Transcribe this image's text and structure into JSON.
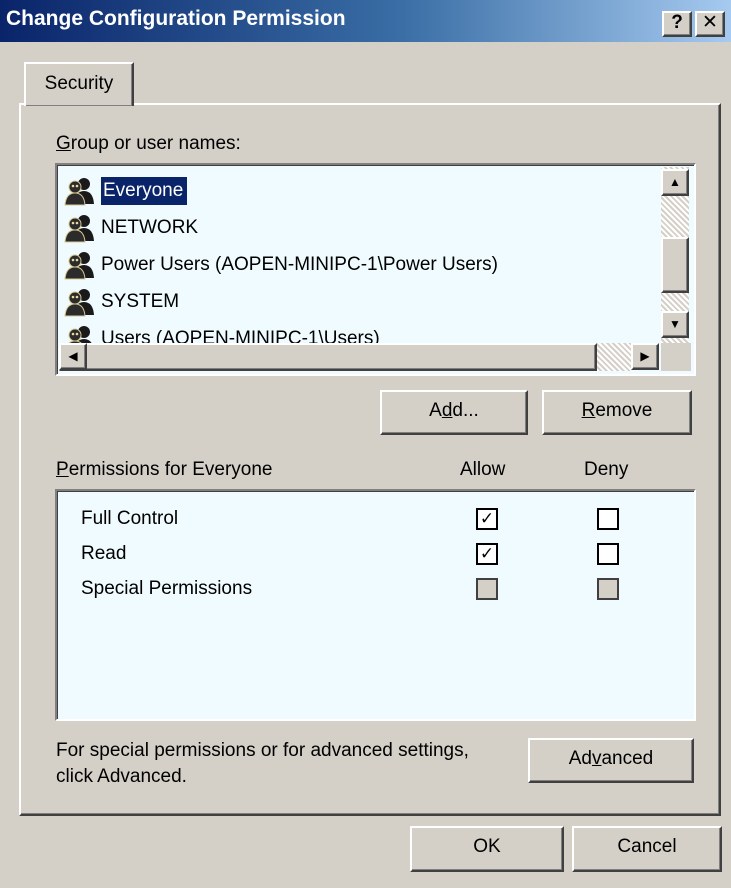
{
  "window": {
    "title": "Change Configuration Permission",
    "help_label": "?",
    "close_label": "✕"
  },
  "tabs": [
    {
      "label": "Security",
      "active": true
    }
  ],
  "group_section": {
    "label_mnemonic": "G",
    "label_rest": "roup or user names:",
    "users": [
      {
        "name": "Everyone",
        "selected": true,
        "icon": "users-group-icon"
      },
      {
        "name": "NETWORK",
        "selected": false,
        "icon": "users-group-icon"
      },
      {
        "name": "Power Users (AOPEN-MINIPC-1\\Power Users)",
        "selected": false,
        "icon": "users-group-icon"
      },
      {
        "name": "SYSTEM",
        "selected": false,
        "icon": "users-group-icon"
      },
      {
        "name": "Users (AOPEN-MINIPC-1\\Users)",
        "selected": false,
        "icon": "users-group-icon"
      }
    ],
    "scroll_up": "▲",
    "scroll_down": "▼",
    "scroll_left": "◀",
    "scroll_right": "▶"
  },
  "buttons": {
    "add_pre": "A",
    "add_mnemonic": "d",
    "add_post": "d...",
    "remove_mnemonic": "R",
    "remove_post": "emove",
    "advanced_pre": "Ad",
    "advanced_mnemonic": "v",
    "advanced_post": "anced",
    "ok": "OK",
    "cancel": "Cancel"
  },
  "permissions": {
    "label_mnemonic": "P",
    "label_rest": "ermissions for Everyone",
    "allow_header": "Allow",
    "deny_header": "Deny",
    "rows": [
      {
        "name": "Full Control",
        "allow": true,
        "deny": false,
        "disabled": false
      },
      {
        "name": "Read",
        "allow": true,
        "deny": false,
        "disabled": false
      },
      {
        "name": "Special Permissions",
        "allow": false,
        "deny": false,
        "disabled": true
      }
    ]
  },
  "advanced_hint": {
    "line1": "For special permissions or for advanced settings,",
    "line2": "click Advanced."
  },
  "colors": {
    "face": "#d4d0c8",
    "selection": "#0a246a",
    "title_start": "#0a246a",
    "title_end": "#a6caf0",
    "list_bg": "#f0fbff"
  }
}
